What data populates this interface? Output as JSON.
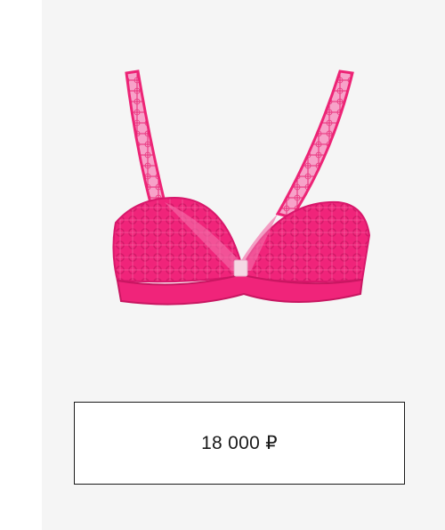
{
  "product": {
    "image_icon": "bra-product-image",
    "main_color": "#f0247a",
    "shadow_color": "#c81661"
  },
  "price": {
    "label": "18 000 ₽"
  }
}
